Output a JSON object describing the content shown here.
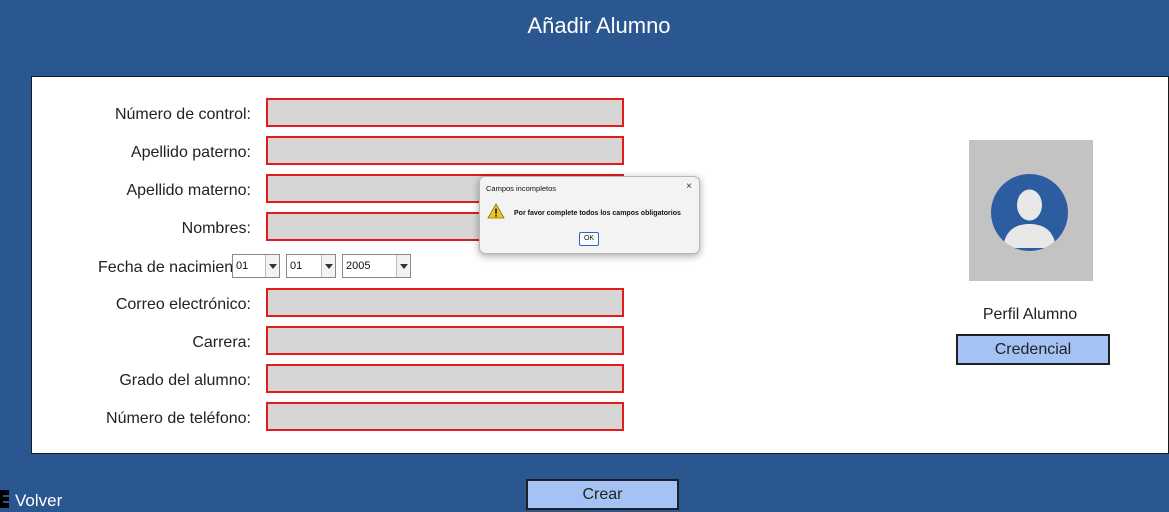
{
  "header": {
    "title": "Añadir Alumno"
  },
  "form": {
    "labels": {
      "numero_control": "Número de control:",
      "apellido_paterno": "Apellido paterno:",
      "apellido_materno": "Apellido materno:",
      "nombres": "Nombres:",
      "fecha_nacimiento": "Fecha de nacimiento:",
      "correo": "Correo electrónico:",
      "carrera": "Carrera:",
      "grado": "Grado del alumno:",
      "telefono": "Número de teléfono:"
    },
    "values": {
      "numero_control": "",
      "apellido_paterno": "",
      "apellido_materno": "",
      "nombres": "",
      "correo": "",
      "carrera": "",
      "grado": "",
      "telefono": ""
    },
    "birthdate": {
      "day": "01",
      "month": "01",
      "year": "2005"
    }
  },
  "profile": {
    "label": "Perfil Alumno",
    "credencial_button": "Credencial"
  },
  "actions": {
    "crear_button": "Crear",
    "volver_link": "Volver"
  },
  "dialog": {
    "title": "Campos incompletos",
    "close_glyph": "×",
    "message": "Por favor complete todos los campos obligatorios",
    "ok_button": "OK"
  },
  "colors": {
    "background": "#2a5790",
    "panel": "#ffffff",
    "field_fill": "#d6d6d6",
    "field_error_border": "#e21b1b",
    "button_fill": "#a4c2f4",
    "avatar_bg": "#c3c3c3",
    "avatar_accent": "#2b5da0"
  }
}
